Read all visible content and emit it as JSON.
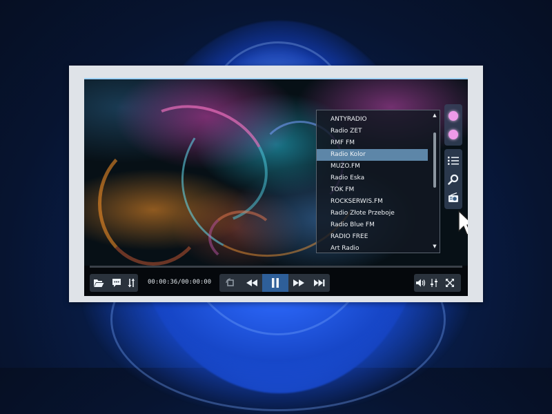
{
  "playlist": {
    "items": [
      "ANTYRADIO",
      "Radio ZET",
      "RMF FM",
      "Radio Kolor",
      "MUZO.FM",
      "Radio Eska",
      "TOK FM",
      "ROCKSERWIS.FM",
      "Radio Złote Przeboje",
      "Radio Blue FM",
      "RADIO FREE",
      "Art Radio"
    ],
    "selected_index": 3
  },
  "controls": {
    "time_display": "00:00:36/00:00:00"
  },
  "icons": {
    "open": "folder-open-icon",
    "subtitles": "subtitles-icon",
    "audio_track": "audio-track-icon",
    "stop": "stop-icon",
    "rewind": "rewind-icon",
    "pause": "pause-icon",
    "forward": "fast-forward-icon",
    "next": "next-track-icon",
    "volume": "volume-icon",
    "equalizer": "equalizer-icon",
    "fullscreen": "fullscreen-icon",
    "playlist": "playlist-icon",
    "search": "search-icon",
    "radio": "radio-icon"
  },
  "colors": {
    "accent": "#2e5f99",
    "selection": "#5d86a8",
    "side_dot": "#ee9ae8"
  }
}
